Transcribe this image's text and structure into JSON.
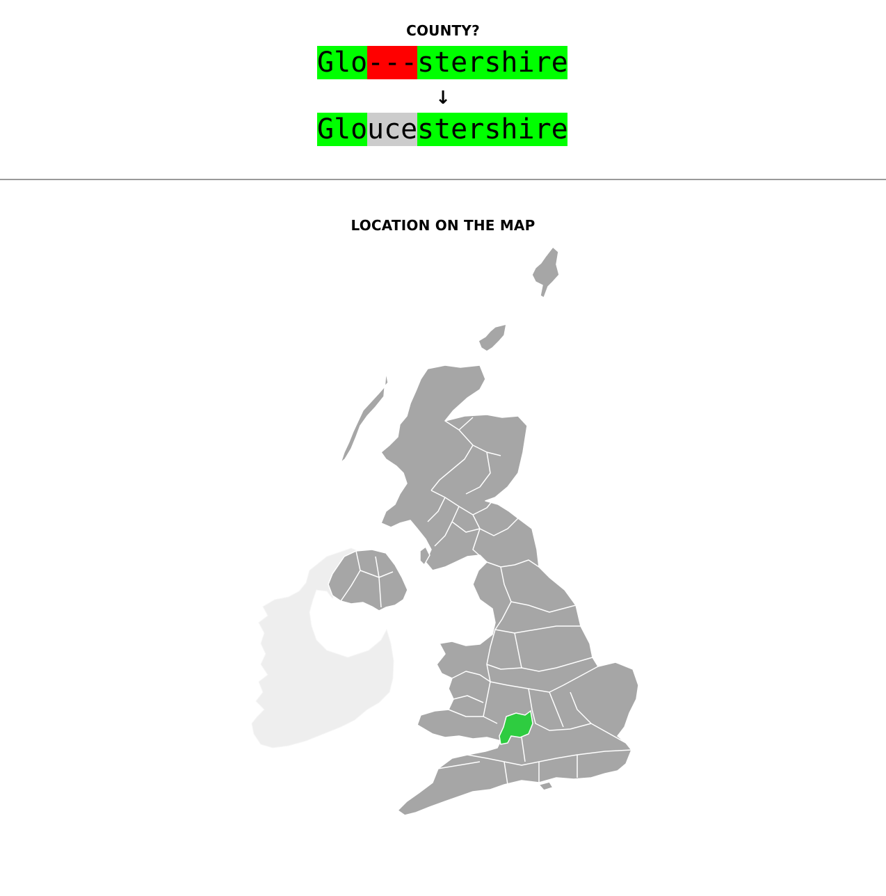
{
  "question": {
    "title": "COUNTY?",
    "guess": {
      "prefix": "Glo",
      "missing": "---",
      "suffix": "stershire"
    },
    "arrow": "↓",
    "answer": {
      "prefix": "Glo",
      "revealed": "uce",
      "suffix": "stershire"
    }
  },
  "map": {
    "title": "LOCATION ON THE MAP",
    "highlighted_county": "Gloucestershire",
    "colors": {
      "correct_letters": "#00ff00",
      "wrong_letters": "#ff0000",
      "revealed_letters": "#cccccc",
      "uk_land": "#a6a6a6",
      "ireland_land": "#eeeeee",
      "highlight": "#2ecc40"
    }
  }
}
